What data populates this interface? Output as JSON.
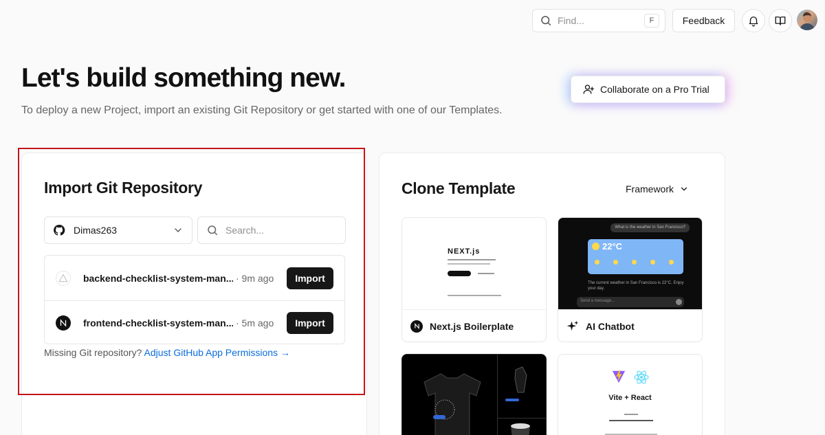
{
  "topbar": {
    "find_placeholder": "Find...",
    "find_shortcut": "F",
    "feedback_label": "Feedback"
  },
  "hero": {
    "title": "Let's build something new.",
    "subtitle": "To deploy a new Project, import an existing Git Repository or get started with one of our Templates.",
    "pro_trial_label": "Collaborate on a Pro Trial"
  },
  "import": {
    "title": "Import Git Repository",
    "account": "Dimas263",
    "search_placeholder": "Search...",
    "repos": [
      {
        "name": "backend-checklist-system-man...",
        "time": "· 9m ago",
        "icon": "triangle-icon",
        "button": "Import"
      },
      {
        "name": "frontend-checklist-system-man...",
        "time": "· 5m ago",
        "icon": "nextjs-icon",
        "button": "Import"
      }
    ],
    "missing_text": "Missing Git repository?",
    "missing_link": "Adjust GitHub App Permissions →"
  },
  "clone": {
    "title": "Clone Template",
    "filter_label": "Framework",
    "templates": [
      {
        "name": "Next.js Boilerplate",
        "icon": "nextjs-icon"
      },
      {
        "name": "AI Chatbot",
        "icon": "sparkles-icon"
      },
      {
        "name": "",
        "icon": ""
      },
      {
        "name": "",
        "icon": ""
      }
    ],
    "thumb_texts": {
      "next_logo": "NEXT.js",
      "weather_question": "What is the weather in San Francisco?",
      "weather_temp": "22°C",
      "weather_reply": "The current weather in San Francisco is 22°C. Enjoy your day.",
      "chat_placeholder": "Send a message...",
      "vite_react": "Vite + React"
    }
  },
  "colors": {
    "accent_link": "#0a6cdb",
    "highlight_border": "#c41418",
    "button_dark": "#171717"
  }
}
